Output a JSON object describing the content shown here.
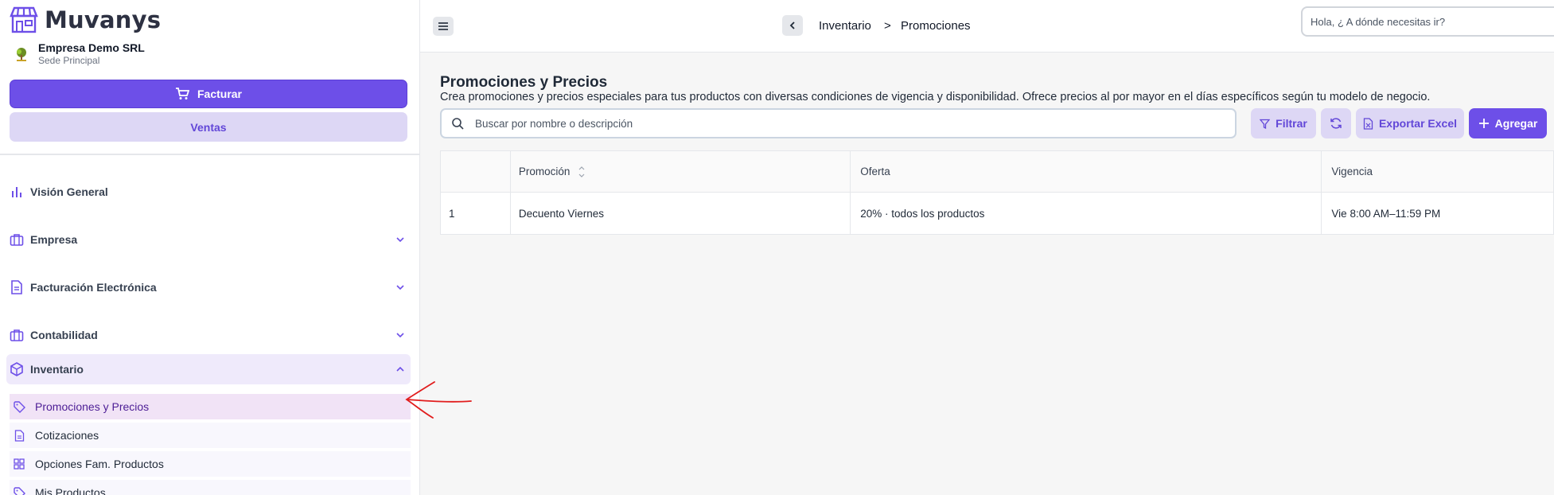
{
  "brand": {
    "name": "Muvanys",
    "accent": "#6d4fe8"
  },
  "company": {
    "name": "Empresa Demo SRL",
    "branch": "Sede Principal"
  },
  "actions": {
    "facturar": "Facturar",
    "ventas": "Ventas"
  },
  "nav": {
    "items": [
      {
        "label": "Visión General",
        "icon": "bar-chart-icon"
      },
      {
        "label": "Empresa",
        "icon": "briefcase-icon"
      },
      {
        "label": "Facturación Electrónica",
        "icon": "document-icon"
      },
      {
        "label": "Contabilidad",
        "icon": "briefcase-icon"
      },
      {
        "label": "Inventario",
        "icon": "box-icon",
        "expanded": true
      }
    ],
    "subitems": [
      {
        "label": "Promociones y Precios",
        "icon": "tag-icon",
        "active": true
      },
      {
        "label": "Cotizaciones",
        "icon": "document-icon"
      },
      {
        "label": "Opciones Fam. Productos",
        "icon": "grid-icon"
      },
      {
        "label": "Mis Productos",
        "icon": "tag-icon"
      }
    ]
  },
  "topbar": {
    "breadcrumb": [
      "Inventario",
      "Promociones"
    ],
    "breadcrumb_separator": ">",
    "search_placeholder": "Hola, ¿ A dónde necesitas ir?"
  },
  "page": {
    "title": "Promociones y Precios",
    "description": "Crea promociones y precios especiales para tus productos con diversas condiciones de vigencia y disponibilidad. Ofrece precios al por mayor en el días específicos según tu modelo de negocio.",
    "search_placeholder": "Buscar por nombre o descripción",
    "buttons": {
      "filter": "Filtrar",
      "export": "Exportar Excel",
      "add": "Agregar"
    }
  },
  "table": {
    "columns": [
      "",
      "Promoción",
      "Oferta",
      "Vigencia"
    ],
    "rows": [
      [
        "1",
        "Decuento Viernes",
        "20% · todos los productos",
        "Vie 8:00 AM–11:59 PM"
      ]
    ]
  }
}
